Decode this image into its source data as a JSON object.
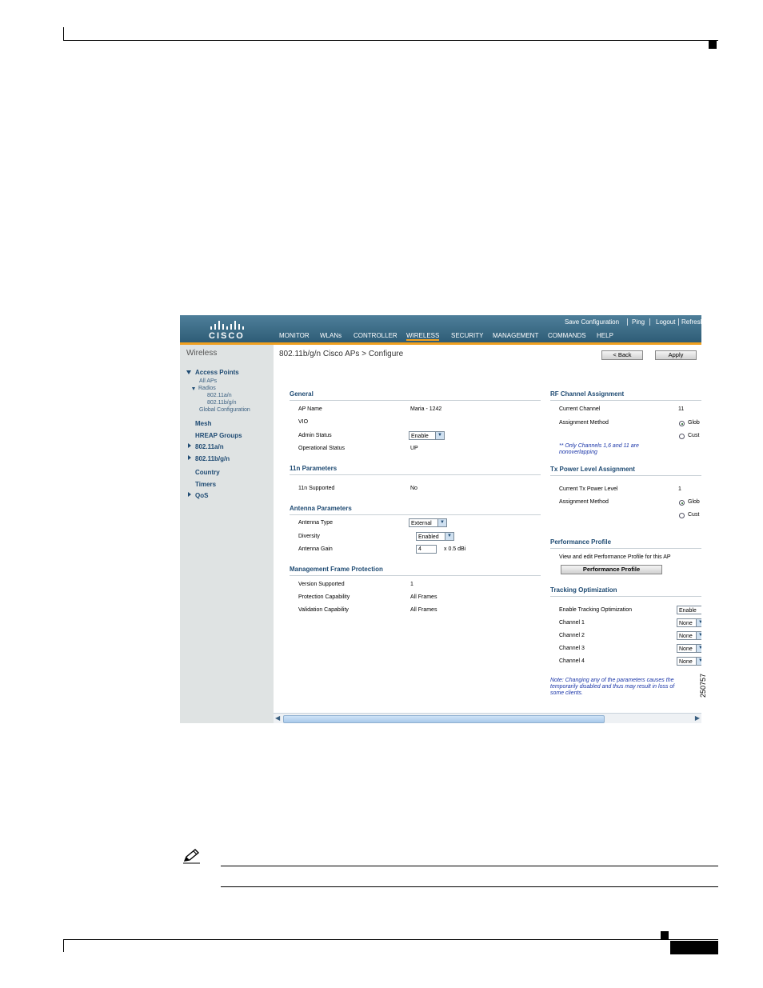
{
  "figure_number": "250757",
  "top_links": [
    "Save Configuration",
    "Ping",
    "Logout",
    "Refresh"
  ],
  "logo": "CISCO",
  "menu": [
    "MONITOR",
    "WLANs",
    "CONTROLLER",
    "WIRELESS",
    "SECURITY",
    "MANAGEMENT",
    "COMMANDS",
    "HELP"
  ],
  "sidebar": {
    "title": "Wireless",
    "access_points": "Access Points",
    "all_aps": "All APs",
    "radios": "Radios",
    "radio_a": "802.11a/n",
    "radio_bg": "802.11b/g/n",
    "global_config": "Global Configuration",
    "mesh": "Mesh",
    "hreap": "HREAP Groups",
    "dot11a": "802.11a/n",
    "dot11bg": "802.11b/g/n",
    "country": "Country",
    "timers": "Timers",
    "qos": "QoS"
  },
  "page": {
    "title": "802.11b/g/n Cisco APs > Configure",
    "back_button": "< Back",
    "apply_button": "Apply"
  },
  "general": {
    "heading": "General",
    "ap_name_label": "AP Name",
    "ap_name_value": "Maria - 1242",
    "vio_label": "VIO",
    "admin_status_label": "Admin Status",
    "admin_status_value": "Enable",
    "oper_status_label": "Operational Status",
    "oper_status_value": "UP"
  },
  "n_params": {
    "heading": "11n Parameters",
    "supported_label": "11n Supported",
    "supported_value": "No"
  },
  "antenna": {
    "heading": "Antenna Parameters",
    "type_label": "Antenna Type",
    "type_value": "External",
    "diversity_label": "Diversity",
    "diversity_value": "Enabled",
    "gain_label": "Antenna Gain",
    "gain_value": "4",
    "gain_unit": "x 0.5 dBi"
  },
  "mfp": {
    "heading": "Management Frame Protection",
    "version_label": "Version Supported",
    "version_value": "1",
    "protection_label": "Protection Capability",
    "protection_value": "All Frames",
    "validation_label": "Validation Capability",
    "validation_value": "All Frames"
  },
  "rf_channel": {
    "heading": "RF Channel Assignment",
    "current_label": "Current Channel",
    "current_value": "11",
    "method_label": "Assignment Method",
    "opt_global": "Glob",
    "opt_custom": "Cust",
    "note_line1": "** Only Channels 1,6 and 11 are",
    "note_line2": "nonoverlapping"
  },
  "tx_power": {
    "heading": "Tx Power Level Assignment",
    "current_label": "Current Tx Power Level",
    "current_value": "1",
    "method_label": "Assignment Method",
    "opt_global": "Glob",
    "opt_custom": "Cust"
  },
  "perf": {
    "heading": "Performance Profile",
    "desc": "View and edit Performance Profile for this AP",
    "button": "Performance Profile"
  },
  "tracking": {
    "heading": "Tracking Optimization",
    "enable_label": "Enable Tracking Optimization",
    "enable_value": "Enable",
    "ch1_label": "Channel 1",
    "ch2_label": "Channel 2",
    "ch3_label": "Channel 3",
    "ch4_label": "Channel 4",
    "ch_value": "None"
  },
  "footer_note": {
    "line1": "Note: Changing any of the parameters causes the",
    "line2": "temporarily disabled and thus may result in loss of",
    "line3": "some clients."
  }
}
